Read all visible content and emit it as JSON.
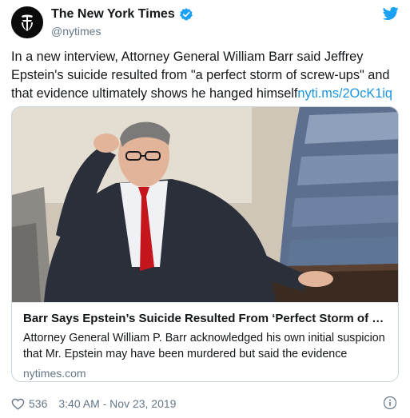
{
  "account": {
    "display_name": "The New York Times",
    "handle": "@nytimes",
    "avatar_icon": "nyt-t-logo",
    "verified_icon": "verified-badge-icon",
    "network_icon": "twitter-bird-icon"
  },
  "tweet": {
    "text": "In a new interview, Attorney General William Barr said Jeffrey Epstein's suicide resulted from \"a perfect storm of screw-ups\" and that evidence ultimately shows he hanged himself",
    "link_text": "nyti.ms/2OcK1iq"
  },
  "card": {
    "title": "Barr Says Epstein’s Suicide Resulted From ‘Perfect Storm of Scr...",
    "description": "Attorney General William P. Barr acknowledged his own initial suspicion that Mr. Epstein may have been murdered but said the evidence",
    "domain": "nytimes.com"
  },
  "footer": {
    "like_count": "536",
    "timestamp": "3:40 AM - Nov 23, 2019",
    "like_icon": "heart-icon",
    "info_icon": "info-icon"
  },
  "colors": {
    "link": "#1b95e0",
    "secondary_text": "#657786",
    "verified": "#1da1f2",
    "border": "#ccd6dd"
  }
}
